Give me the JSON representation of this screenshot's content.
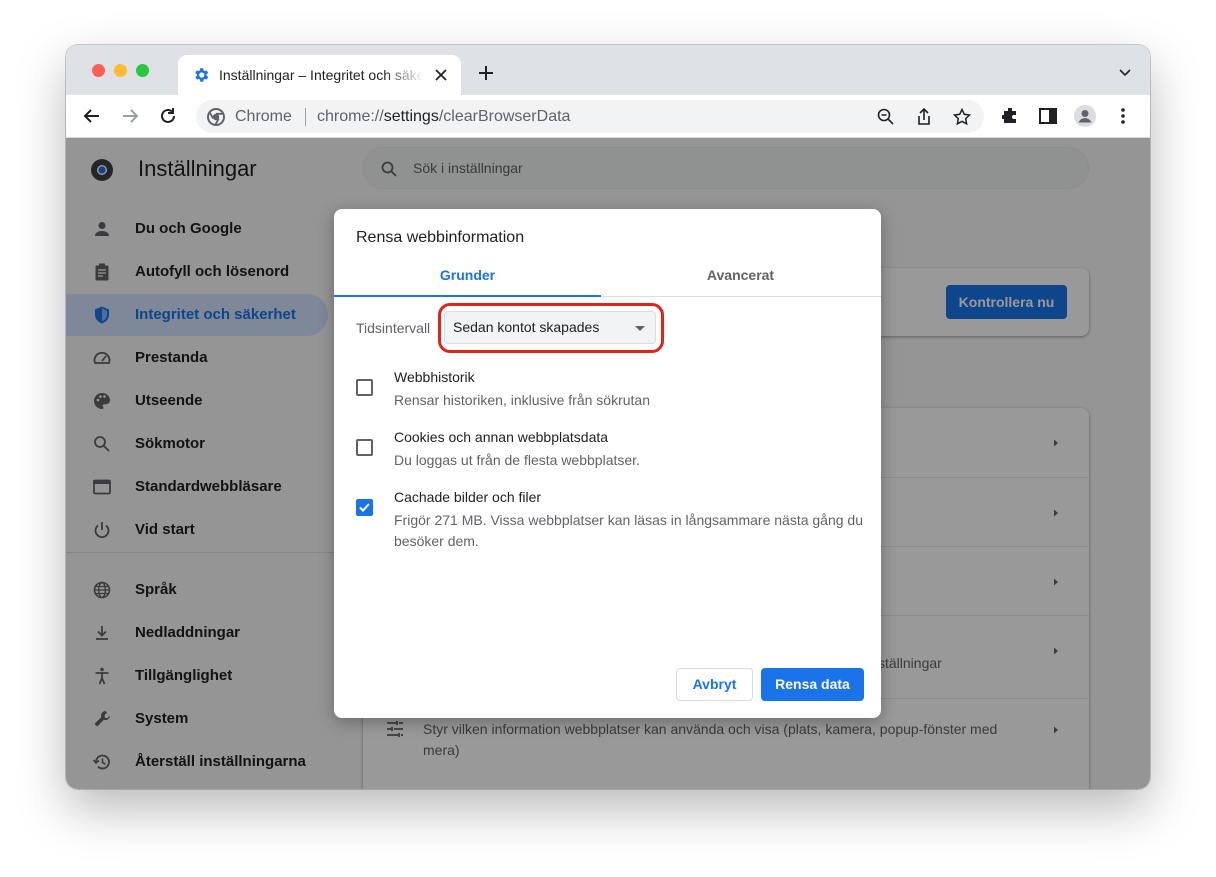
{
  "browser": {
    "tab_title": "Inställningar – Integritet och säkerhet",
    "omnibox_label": "Chrome",
    "url_scheme": "chrome://",
    "url_host": "settings",
    "url_path": "/clearBrowserData"
  },
  "settings": {
    "title": "Inställningar",
    "search_placeholder": "Sök i inställningar",
    "nav": [
      {
        "label": "Du och Google",
        "icon": "person-icon"
      },
      {
        "label": "Autofyll och lösenord",
        "icon": "clipboard-icon"
      },
      {
        "label": "Integritet och säkerhet",
        "icon": "shield-icon",
        "active": true
      },
      {
        "label": "Prestanda",
        "icon": "speedometer-icon"
      },
      {
        "label": "Utseende",
        "icon": "palette-icon"
      },
      {
        "label": "Sökmotor",
        "icon": "search-icon"
      },
      {
        "label": "Standardwebbläsare",
        "icon": "browser-icon"
      },
      {
        "label": "Vid start",
        "icon": "power-icon"
      },
      {
        "label": "Språk",
        "icon": "globe-icon"
      },
      {
        "label": "Nedladdningar",
        "icon": "download-icon"
      },
      {
        "label": "Tillgänglighet",
        "icon": "accessibility-icon"
      },
      {
        "label": "System",
        "icon": "wrench-icon"
      },
      {
        "label": "Återställ inställningarna",
        "icon": "history-icon"
      }
    ],
    "check_now_button": "Kontrollera nu",
    "partial_row_text": "ställningar",
    "site_settings_desc": "Styr vilken information webbplatser kan använda och visa (plats, kamera, popup-fönster med mera)"
  },
  "dialog": {
    "title": "Rensa webbinformation",
    "tabs": {
      "basic": "Grunder",
      "advanced": "Avancerat"
    },
    "time_range_label": "Tidsintervall",
    "time_range_value": "Sedan kontot skapades",
    "options": [
      {
        "title": "Webbhistorik",
        "desc": "Rensar historiken, inklusive från sökrutan",
        "checked": false
      },
      {
        "title": "Cookies och annan webbplatsdata",
        "desc": "Du loggas ut från de flesta webbplatser.",
        "checked": false
      },
      {
        "title": "Cachade bilder och filer",
        "desc": "Frigör 271 MB. Vissa webbplatser kan läsas in långsammare nästa gång du besöker dem.",
        "checked": true
      }
    ],
    "cancel_button": "Avbryt",
    "confirm_button": "Rensa data"
  },
  "colors": {
    "accent": "#1a73e8",
    "highlight": "#e2231a"
  }
}
